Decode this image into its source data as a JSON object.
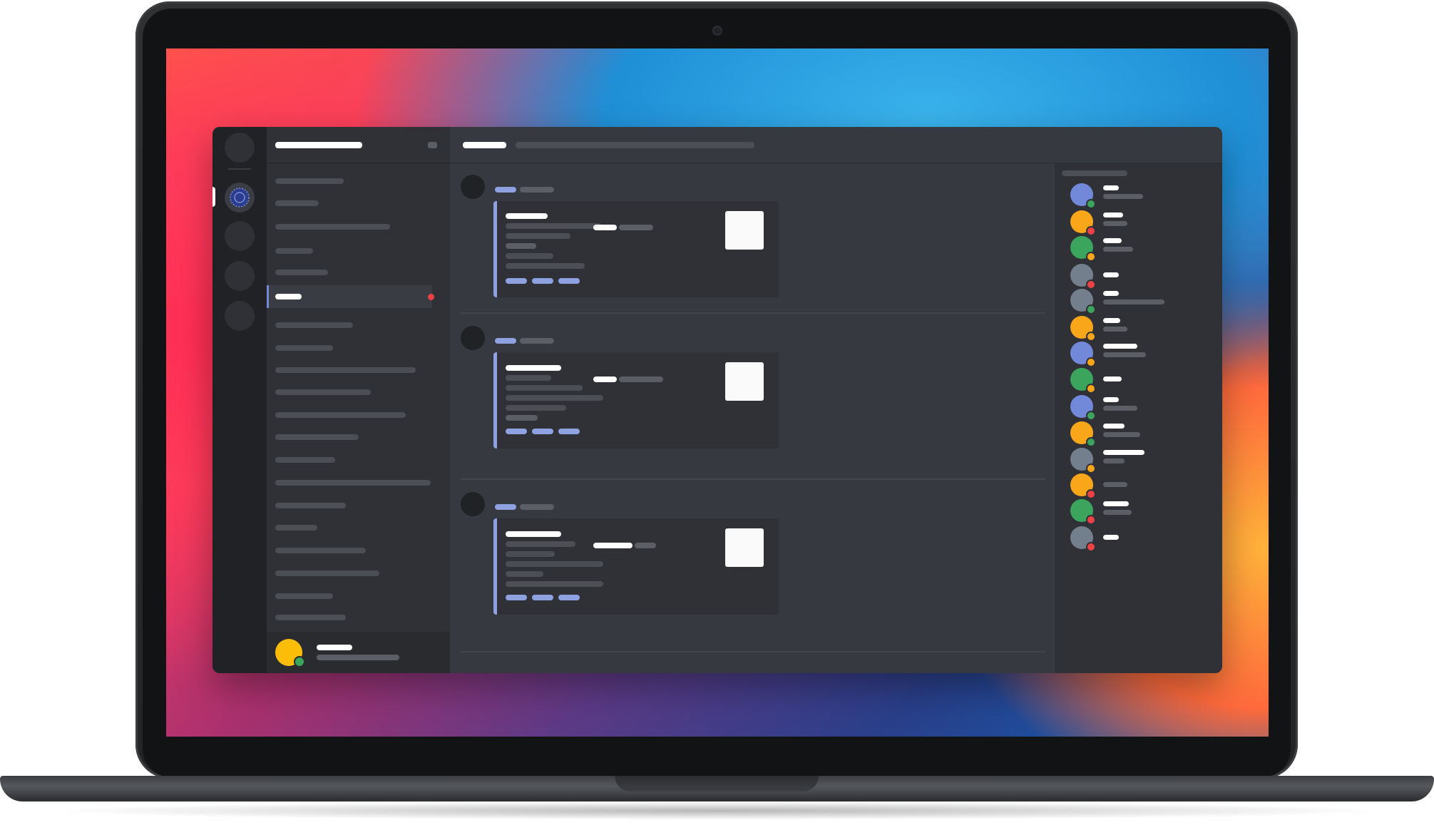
{
  "theme": {
    "accent": "#8ea1e1",
    "blurple": "#7289da",
    "online": "#3ba55d",
    "idle": "#faa61a",
    "dnd": "#ed4245",
    "guild_bar": "#202225",
    "sidebar": "#2f3136",
    "chat": "#36393f"
  },
  "members": [
    {
      "avatar_color": "#7289da",
      "status": "online"
    },
    {
      "avatar_color": "#faa61a",
      "status": "dnd"
    },
    {
      "avatar_color": "#3ba55d",
      "status": "idle"
    },
    {
      "avatar_color": "#747f8d",
      "status": "dnd"
    },
    {
      "avatar_color": "#747f8d",
      "status": "online"
    },
    {
      "avatar_color": "#faa61a",
      "status": "idle"
    },
    {
      "avatar_color": "#7289da",
      "status": "idle"
    },
    {
      "avatar_color": "#3ba55d",
      "status": "idle"
    },
    {
      "avatar_color": "#7289da",
      "status": "online"
    },
    {
      "avatar_color": "#faa61a",
      "status": "online"
    },
    {
      "avatar_color": "#747f8d",
      "status": "idle"
    },
    {
      "avatar_color": "#faa61a",
      "status": "dnd"
    },
    {
      "avatar_color": "#3ba55d",
      "status": "dnd"
    },
    {
      "avatar_color": "#747f8d",
      "status": "dnd"
    }
  ],
  "current_user": {
    "avatar_color": "#fbbd08",
    "status": "online"
  },
  "icons": {
    "server_active": "globe-icon",
    "header_action": "settings-icon"
  }
}
